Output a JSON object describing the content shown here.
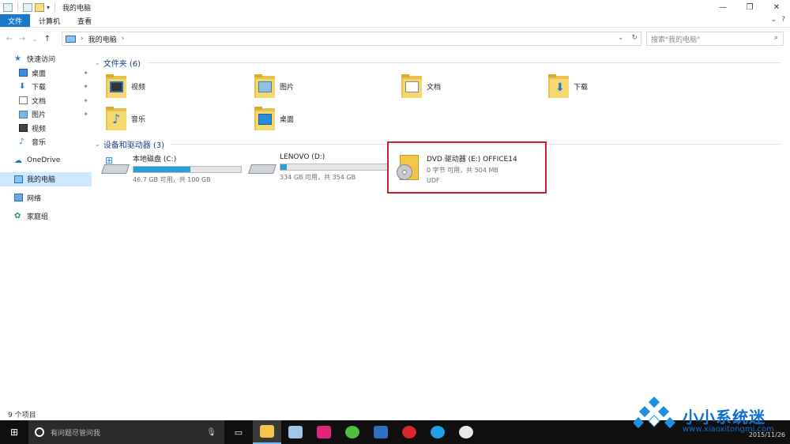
{
  "window": {
    "title": "我的电脑",
    "controls": {
      "minimize": "—",
      "maximize": "❐",
      "close": "✕"
    }
  },
  "ribbon": {
    "tabs": [
      {
        "label": "文件",
        "active": true
      },
      {
        "label": "计算机",
        "active": false
      },
      {
        "label": "查看",
        "active": false
      }
    ],
    "right": {
      "expand": "⌄",
      "help": "?"
    }
  },
  "address": {
    "path_label": "我的电脑",
    "back": "←",
    "forward": "→",
    "recent": "⌄",
    "up": "↑",
    "dropdown": "⌄",
    "refresh": "↻",
    "search_placeholder": "搜索\"我的电脑\""
  },
  "nav": {
    "quick_access": "快速访问",
    "quick_items": [
      {
        "label": "桌面",
        "icon": "desktop-icon",
        "pinned": true
      },
      {
        "label": "下载",
        "icon": "download-icon",
        "pinned": true
      },
      {
        "label": "文档",
        "icon": "document-icon",
        "pinned": true
      },
      {
        "label": "图片",
        "icon": "picture-icon",
        "pinned": true
      },
      {
        "label": "视频",
        "icon": "video-icon",
        "pinned": false
      },
      {
        "label": "音乐",
        "icon": "music-icon",
        "pinned": false
      }
    ],
    "onedrive": "OneDrive",
    "this_pc": "我的电脑",
    "network": "网络",
    "homegroup": "家庭组"
  },
  "folders": {
    "header": "文件夹 (6)",
    "items": [
      "视频",
      "图片",
      "文档",
      "下载",
      "音乐",
      "桌面"
    ]
  },
  "devices": {
    "header": "设备和驱动器 (3)",
    "drives": [
      {
        "name": "本地磁盘 (C:)",
        "detail": "46.7 GB 可用，共 100 GB",
        "used_fraction": 0.533
      },
      {
        "name": "LENOVO (D:)",
        "detail": "334 GB 可用，共 354 GB",
        "used_fraction": 0.056
      }
    ],
    "dvd": {
      "name": "DVD 驱动器 (E:) OFFICE14",
      "detail": "0 字节 可用，共 504 MB",
      "fs": "UDF"
    }
  },
  "status": {
    "count": "9 个项目"
  },
  "taskbar": {
    "search_placeholder": "有问题尽管问我",
    "clock_date": "2015/11/26"
  },
  "watermark": {
    "text": "小小系统迷",
    "url": "www.xiaoxitongmi.com"
  },
  "colors": {
    "accent": "#1979ca",
    "highlight_border": "#c8202f",
    "bar_fill": "#26a0da"
  }
}
